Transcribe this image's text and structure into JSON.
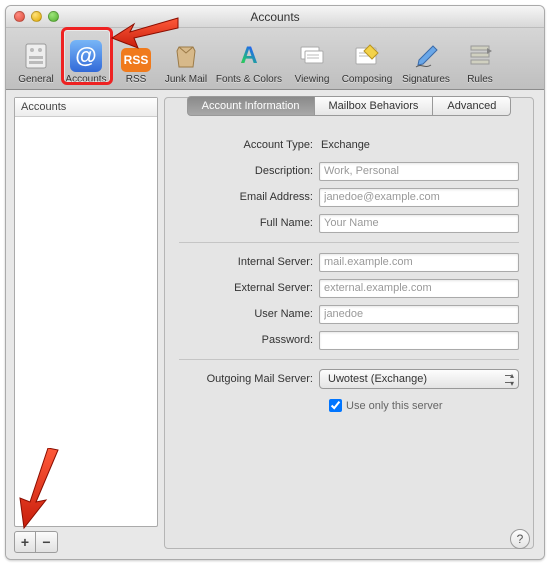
{
  "window": {
    "title": "Accounts"
  },
  "toolbar": {
    "items": [
      {
        "label": "General"
      },
      {
        "label": "Accounts"
      },
      {
        "label": "RSS"
      },
      {
        "label": "Junk Mail"
      },
      {
        "label": "Fonts & Colors"
      },
      {
        "label": "Viewing"
      },
      {
        "label": "Composing"
      },
      {
        "label": "Signatures"
      },
      {
        "label": "Rules"
      }
    ],
    "selected_index": 1
  },
  "sidebar": {
    "header": "Accounts",
    "add_label": "+",
    "remove_label": "−"
  },
  "tabs": {
    "items": [
      "Account Information",
      "Mailbox Behaviors",
      "Advanced"
    ],
    "active_index": 0
  },
  "form": {
    "account_type_label": "Account Type:",
    "account_type_value": "Exchange",
    "description_label": "Description:",
    "description_placeholder": "Work, Personal",
    "email_label": "Email Address:",
    "email_placeholder": "janedoe@example.com",
    "fullname_label": "Full Name:",
    "fullname_placeholder": "Your Name",
    "internal_label": "Internal Server:",
    "internal_placeholder": "mail.example.com",
    "external_label": "External Server:",
    "external_placeholder": "external.example.com",
    "username_label": "User Name:",
    "username_placeholder": "janedoe",
    "password_label": "Password:",
    "outgoing_label": "Outgoing Mail Server:",
    "outgoing_value": "Uwotest (Exchange)",
    "use_only_label": "Use only this server"
  },
  "help": {
    "label": "?"
  }
}
